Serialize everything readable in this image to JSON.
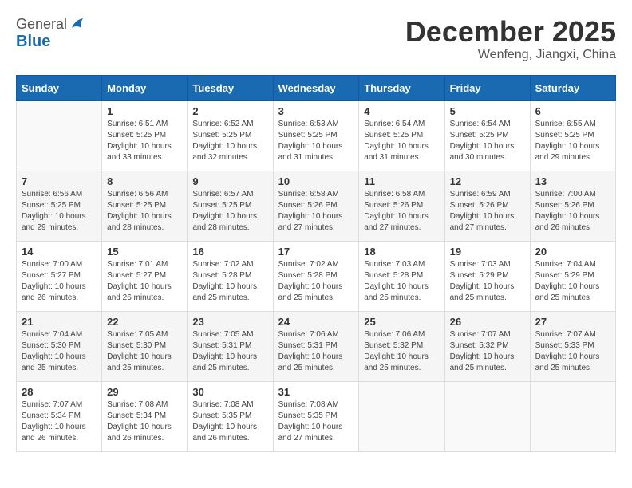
{
  "logo": {
    "general": "General",
    "blue": "Blue"
  },
  "title": "December 2025",
  "location": "Wenfeng, Jiangxi, China",
  "days_header": [
    "Sunday",
    "Monday",
    "Tuesday",
    "Wednesday",
    "Thursday",
    "Friday",
    "Saturday"
  ],
  "weeks": [
    [
      {
        "day": "",
        "sunrise": "",
        "sunset": "",
        "daylight": ""
      },
      {
        "day": "1",
        "sunrise": "Sunrise: 6:51 AM",
        "sunset": "Sunset: 5:25 PM",
        "daylight": "Daylight: 10 hours and 33 minutes."
      },
      {
        "day": "2",
        "sunrise": "Sunrise: 6:52 AM",
        "sunset": "Sunset: 5:25 PM",
        "daylight": "Daylight: 10 hours and 32 minutes."
      },
      {
        "day": "3",
        "sunrise": "Sunrise: 6:53 AM",
        "sunset": "Sunset: 5:25 PM",
        "daylight": "Daylight: 10 hours and 31 minutes."
      },
      {
        "day": "4",
        "sunrise": "Sunrise: 6:54 AM",
        "sunset": "Sunset: 5:25 PM",
        "daylight": "Daylight: 10 hours and 31 minutes."
      },
      {
        "day": "5",
        "sunrise": "Sunrise: 6:54 AM",
        "sunset": "Sunset: 5:25 PM",
        "daylight": "Daylight: 10 hours and 30 minutes."
      },
      {
        "day": "6",
        "sunrise": "Sunrise: 6:55 AM",
        "sunset": "Sunset: 5:25 PM",
        "daylight": "Daylight: 10 hours and 29 minutes."
      }
    ],
    [
      {
        "day": "7",
        "sunrise": "Sunrise: 6:56 AM",
        "sunset": "Sunset: 5:25 PM",
        "daylight": "Daylight: 10 hours and 29 minutes."
      },
      {
        "day": "8",
        "sunrise": "Sunrise: 6:56 AM",
        "sunset": "Sunset: 5:25 PM",
        "daylight": "Daylight: 10 hours and 28 minutes."
      },
      {
        "day": "9",
        "sunrise": "Sunrise: 6:57 AM",
        "sunset": "Sunset: 5:25 PM",
        "daylight": "Daylight: 10 hours and 28 minutes."
      },
      {
        "day": "10",
        "sunrise": "Sunrise: 6:58 AM",
        "sunset": "Sunset: 5:26 PM",
        "daylight": "Daylight: 10 hours and 27 minutes."
      },
      {
        "day": "11",
        "sunrise": "Sunrise: 6:58 AM",
        "sunset": "Sunset: 5:26 PM",
        "daylight": "Daylight: 10 hours and 27 minutes."
      },
      {
        "day": "12",
        "sunrise": "Sunrise: 6:59 AM",
        "sunset": "Sunset: 5:26 PM",
        "daylight": "Daylight: 10 hours and 27 minutes."
      },
      {
        "day": "13",
        "sunrise": "Sunrise: 7:00 AM",
        "sunset": "Sunset: 5:26 PM",
        "daylight": "Daylight: 10 hours and 26 minutes."
      }
    ],
    [
      {
        "day": "14",
        "sunrise": "Sunrise: 7:00 AM",
        "sunset": "Sunset: 5:27 PM",
        "daylight": "Daylight: 10 hours and 26 minutes."
      },
      {
        "day": "15",
        "sunrise": "Sunrise: 7:01 AM",
        "sunset": "Sunset: 5:27 PM",
        "daylight": "Daylight: 10 hours and 26 minutes."
      },
      {
        "day": "16",
        "sunrise": "Sunrise: 7:02 AM",
        "sunset": "Sunset: 5:28 PM",
        "daylight": "Daylight: 10 hours and 25 minutes."
      },
      {
        "day": "17",
        "sunrise": "Sunrise: 7:02 AM",
        "sunset": "Sunset: 5:28 PM",
        "daylight": "Daylight: 10 hours and 25 minutes."
      },
      {
        "day": "18",
        "sunrise": "Sunrise: 7:03 AM",
        "sunset": "Sunset: 5:28 PM",
        "daylight": "Daylight: 10 hours and 25 minutes."
      },
      {
        "day": "19",
        "sunrise": "Sunrise: 7:03 AM",
        "sunset": "Sunset: 5:29 PM",
        "daylight": "Daylight: 10 hours and 25 minutes."
      },
      {
        "day": "20",
        "sunrise": "Sunrise: 7:04 AM",
        "sunset": "Sunset: 5:29 PM",
        "daylight": "Daylight: 10 hours and 25 minutes."
      }
    ],
    [
      {
        "day": "21",
        "sunrise": "Sunrise: 7:04 AM",
        "sunset": "Sunset: 5:30 PM",
        "daylight": "Daylight: 10 hours and 25 minutes."
      },
      {
        "day": "22",
        "sunrise": "Sunrise: 7:05 AM",
        "sunset": "Sunset: 5:30 PM",
        "daylight": "Daylight: 10 hours and 25 minutes."
      },
      {
        "day": "23",
        "sunrise": "Sunrise: 7:05 AM",
        "sunset": "Sunset: 5:31 PM",
        "daylight": "Daylight: 10 hours and 25 minutes."
      },
      {
        "day": "24",
        "sunrise": "Sunrise: 7:06 AM",
        "sunset": "Sunset: 5:31 PM",
        "daylight": "Daylight: 10 hours and 25 minutes."
      },
      {
        "day": "25",
        "sunrise": "Sunrise: 7:06 AM",
        "sunset": "Sunset: 5:32 PM",
        "daylight": "Daylight: 10 hours and 25 minutes."
      },
      {
        "day": "26",
        "sunrise": "Sunrise: 7:07 AM",
        "sunset": "Sunset: 5:32 PM",
        "daylight": "Daylight: 10 hours and 25 minutes."
      },
      {
        "day": "27",
        "sunrise": "Sunrise: 7:07 AM",
        "sunset": "Sunset: 5:33 PM",
        "daylight": "Daylight: 10 hours and 25 minutes."
      }
    ],
    [
      {
        "day": "28",
        "sunrise": "Sunrise: 7:07 AM",
        "sunset": "Sunset: 5:34 PM",
        "daylight": "Daylight: 10 hours and 26 minutes."
      },
      {
        "day": "29",
        "sunrise": "Sunrise: 7:08 AM",
        "sunset": "Sunset: 5:34 PM",
        "daylight": "Daylight: 10 hours and 26 minutes."
      },
      {
        "day": "30",
        "sunrise": "Sunrise: 7:08 AM",
        "sunset": "Sunset: 5:35 PM",
        "daylight": "Daylight: 10 hours and 26 minutes."
      },
      {
        "day": "31",
        "sunrise": "Sunrise: 7:08 AM",
        "sunset": "Sunset: 5:35 PM",
        "daylight": "Daylight: 10 hours and 27 minutes."
      },
      {
        "day": "",
        "sunrise": "",
        "sunset": "",
        "daylight": ""
      },
      {
        "day": "",
        "sunrise": "",
        "sunset": "",
        "daylight": ""
      },
      {
        "day": "",
        "sunrise": "",
        "sunset": "",
        "daylight": ""
      }
    ]
  ]
}
